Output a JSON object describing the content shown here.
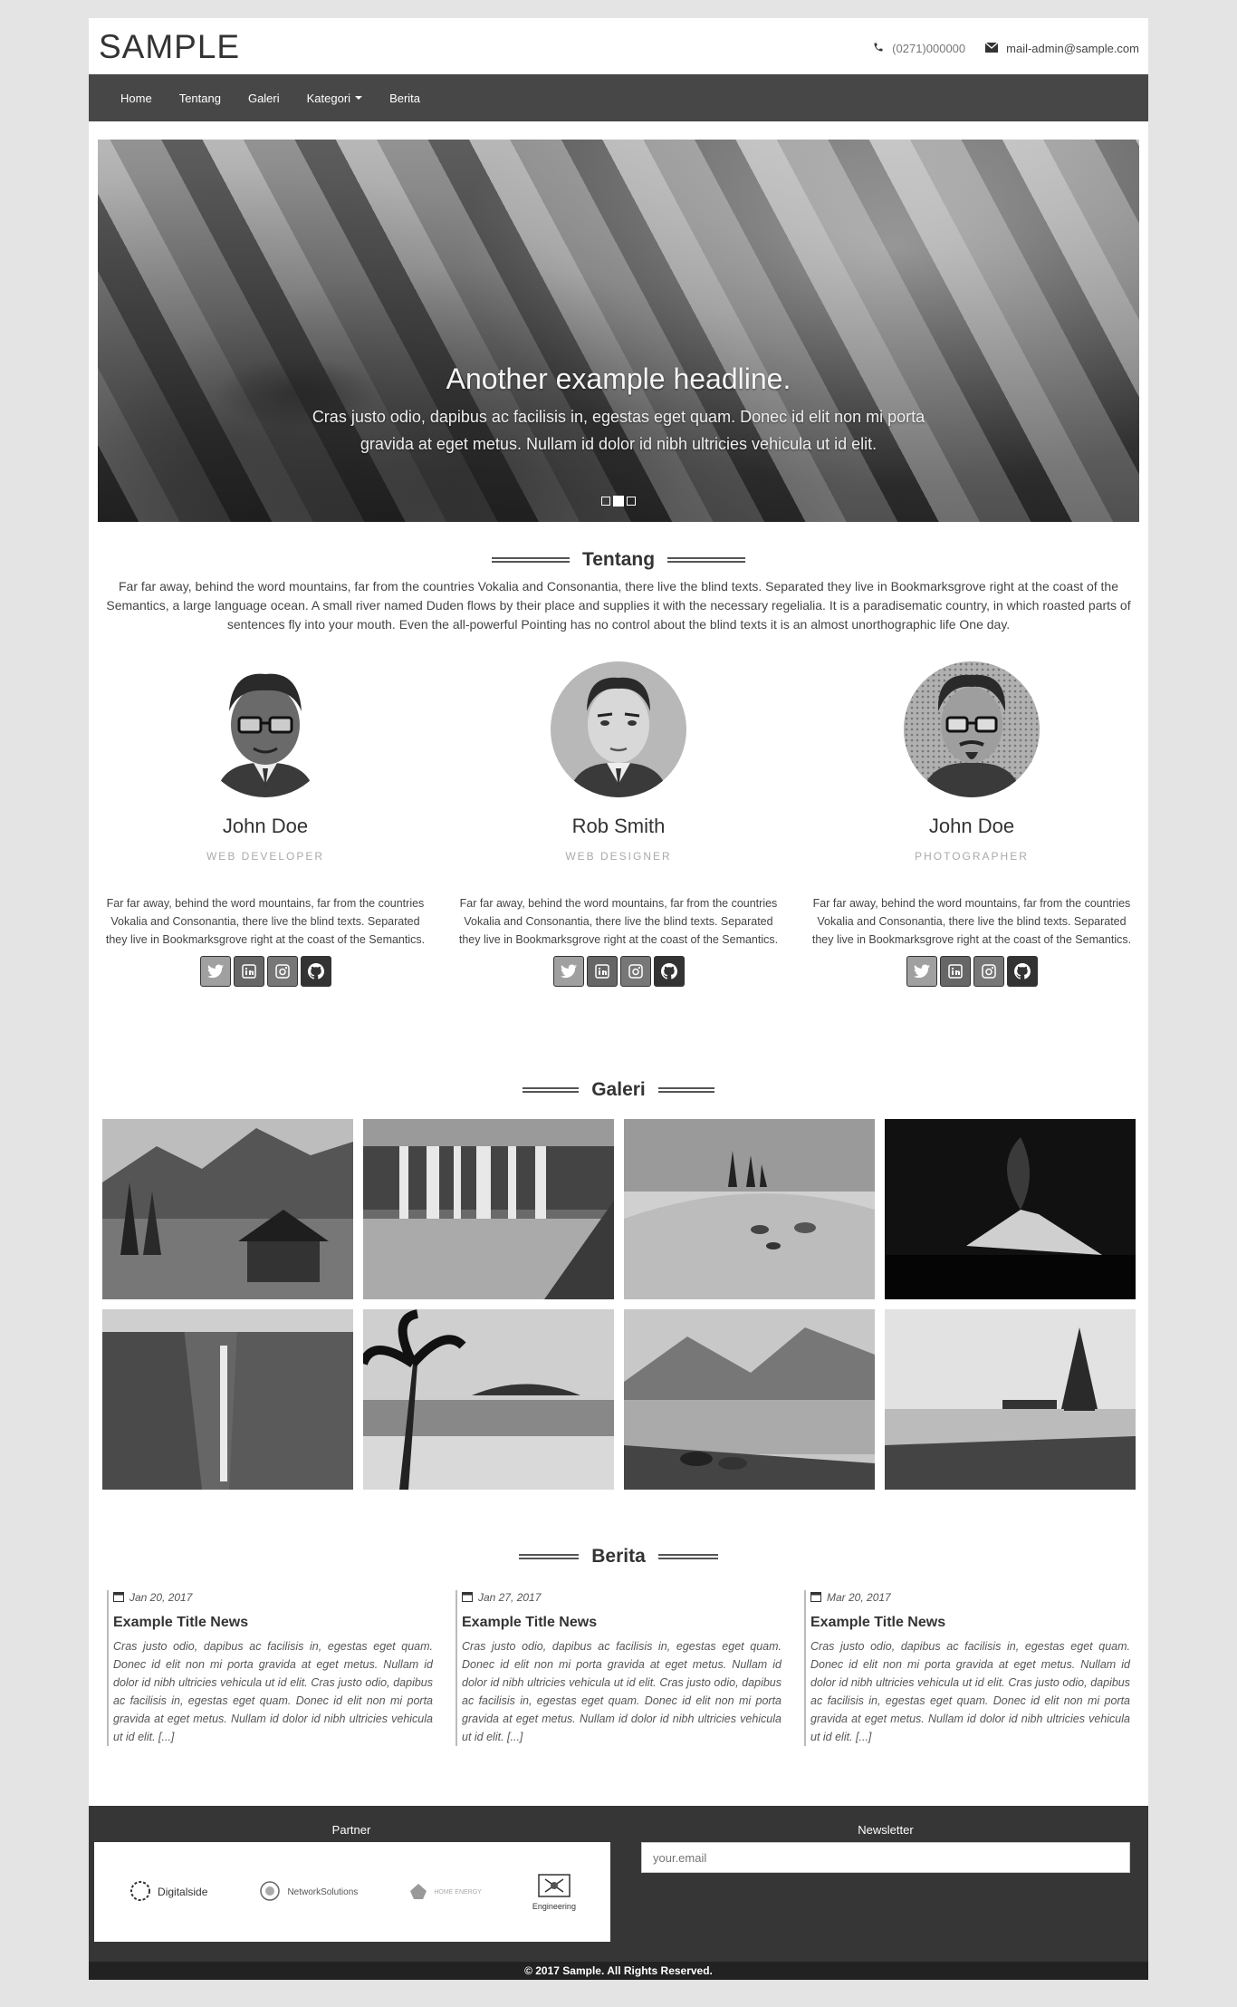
{
  "brand": "SAMPLE",
  "contact": {
    "phone": "(0271)000000",
    "email": "mail-admin@sample.com"
  },
  "nav": {
    "items": [
      "Home",
      "Tentang",
      "Galeri",
      "Kategori",
      "Berita"
    ]
  },
  "carousel": {
    "headline": "Another example headline.",
    "text": "Cras justo odio, dapibus ac facilisis in, egestas eget quam. Donec id elit non mi porta gravida at eget metus. Nullam id dolor id nibh ultricies vehicula ut id elit.",
    "slide_count": 3,
    "active_slide": 2
  },
  "about": {
    "title": "Tentang",
    "text": "Far far away, behind the word mountains, far from the countries Vokalia and Consonantia, there live the blind texts. Separated they live in Bookmarksgrove right at the coast of the Semantics, a large language ocean. A small river named Duden flows by their place and supplies it with the necessary regelialia. It is a paradisematic country, in which roasted parts of sentences fly into your mouth. Even the all-powerful Pointing has no control about the blind texts it is an almost unorthographic life One day."
  },
  "team": [
    {
      "name": "John Doe",
      "role": "WEB DEVELOPER",
      "bio": "Far far away, behind the word mountains, far from the countries Vokalia and Consonantia, there live the blind texts. Separated they live in Bookmarksgrove right at the coast of the Semantics."
    },
    {
      "name": "Rob Smith",
      "role": "WEB DESIGNER",
      "bio": "Far far away, behind the word mountains, far from the countries Vokalia and Consonantia, there live the blind texts. Separated they live in Bookmarksgrove right at the coast of the Semantics."
    },
    {
      "name": "John Doe",
      "role": "PHOTOGRAPHER",
      "bio": "Far far away, behind the word mountains, far from the countries Vokalia and Consonantia, there live the blind texts. Separated they live in Bookmarksgrove right at the coast of the Semantics."
    }
  ],
  "social_icons": [
    "twitter-icon",
    "linkedin-icon",
    "instagram-icon",
    "github-icon"
  ],
  "gallery": {
    "title": "Galeri"
  },
  "news": {
    "title": "Berita",
    "posts": [
      {
        "date": "Jan 20, 2017",
        "title": "Example Title News",
        "excerpt": "Cras justo odio, dapibus ac facilisis in, egestas eget quam. Donec id elit non mi porta gravida at eget metus. Nullam id dolor id nibh ultricies vehicula ut id elit. Cras justo odio, dapibus ac facilisis in, egestas eget quam. Donec id elit non mi porta gravida at eget metus. Nullam id dolor id nibh ultricies vehicula ut id elit. [...]"
      },
      {
        "date": "Jan 27, 2017",
        "title": "Example Title News",
        "excerpt": "Cras justo odio, dapibus ac facilisis in, egestas eget quam. Donec id elit non mi porta gravida at eget metus. Nullam id dolor id nibh ultricies vehicula ut id elit. Cras justo odio, dapibus ac facilisis in, egestas eget quam. Donec id elit non mi porta gravida at eget metus. Nullam id dolor id nibh ultricies vehicula ut id elit. [...]"
      },
      {
        "date": "Mar 20, 2017",
        "title": "Example Title News",
        "excerpt": "Cras justo odio, dapibus ac facilisis in, egestas eget quam. Donec id elit non mi porta gravida at eget metus. Nullam id dolor id nibh ultricies vehicula ut id elit. Cras justo odio, dapibus ac facilisis in, egestas eget quam. Donec id elit non mi porta gravida at eget metus. Nullam id dolor id nibh ultricies vehicula ut id elit. [...]"
      }
    ]
  },
  "footer": {
    "partner_title": "Partner",
    "newsletter_title": "Newsletter",
    "newsletter_placeholder": "your.email",
    "partners": [
      "Digitalside",
      "NetworkSolutions",
      "HOME ENERGY",
      "Engineering"
    ],
    "copyright": "© 2017 Sample. All Rights Reserved."
  },
  "colors": {
    "navbar": "#474747",
    "footer": "#363636",
    "copyright_bar": "#222222",
    "page_bg": "#e4e4e4"
  }
}
